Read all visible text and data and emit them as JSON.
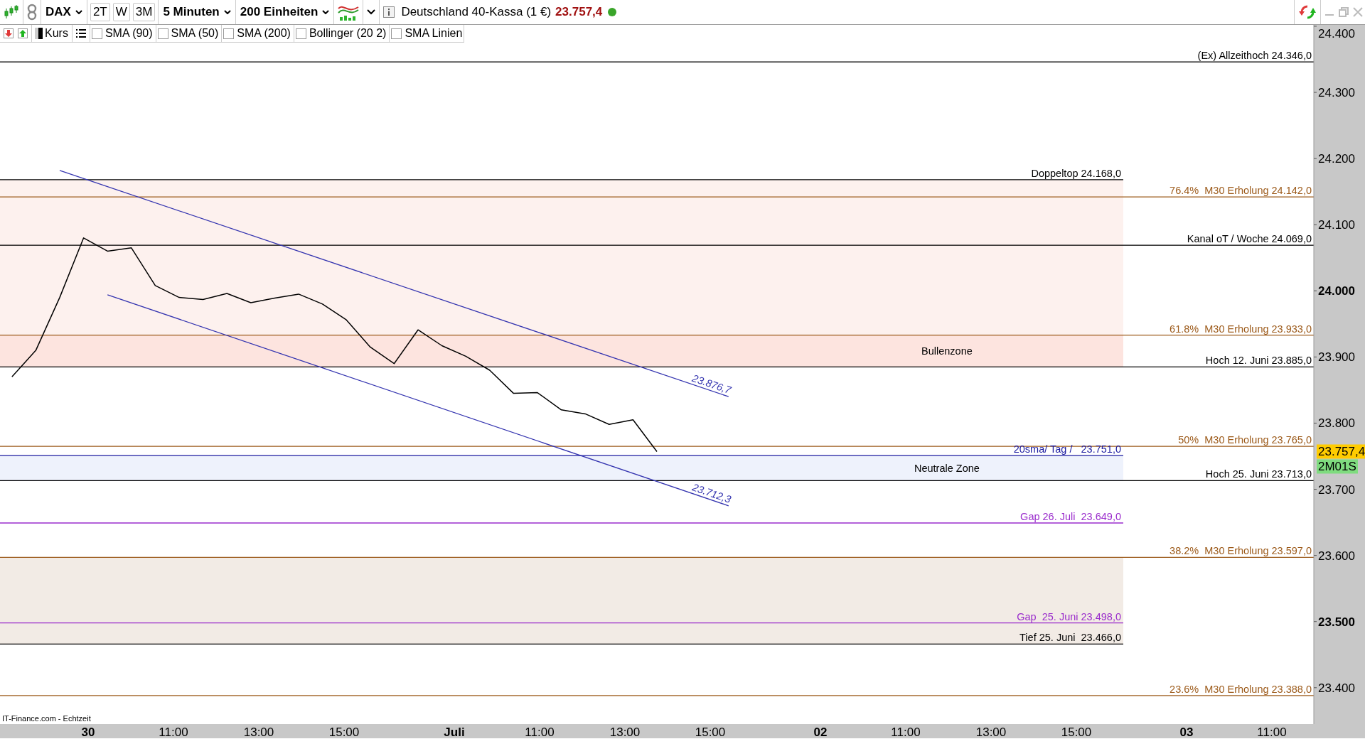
{
  "toolbar": {
    "ranges": [
      {
        "label": "2T"
      },
      {
        "label": "W"
      },
      {
        "label": "3M"
      }
    ],
    "interval": "5 Minuten",
    "units": "200 Einheiten",
    "instrument": "Deutschland 40-Kassa (1 €)",
    "price": "23.757,4",
    "live": true
  },
  "indicator_bar": {
    "indicators": [
      {
        "label": "SMA (90)",
        "checked": false
      },
      {
        "label": "SMA (50)",
        "checked": false
      },
      {
        "label": "SMA (200)",
        "checked": false
      },
      {
        "label": "Bollinger (20 2)",
        "checked": false
      },
      {
        "label": "SMA Linien",
        "checked": false
      }
    ]
  },
  "chart": {
    "price_tag": "23.757,4",
    "timer_tag": "2M01S",
    "source": "IT-Finance.com - Echtzeit",
    "x_axis": [
      {
        "label": "30",
        "kind": "date"
      },
      {
        "label": "11:00",
        "kind": "time"
      },
      {
        "label": "13:00",
        "kind": "time"
      },
      {
        "label": "15:00",
        "kind": "time"
      },
      {
        "label": "Juli",
        "kind": "date"
      },
      {
        "label": "11:00",
        "kind": "time"
      },
      {
        "label": "13:00",
        "kind": "time"
      },
      {
        "label": "15:00",
        "kind": "time"
      },
      {
        "label": "02",
        "kind": "date"
      },
      {
        "label": "11:00",
        "kind": "time"
      },
      {
        "label": "13:00",
        "kind": "time"
      },
      {
        "label": "15:00",
        "kind": "time"
      },
      {
        "label": "03",
        "kind": "date"
      },
      {
        "label": "11:00",
        "kind": "time"
      }
    ],
    "level_layout": [
      {
        "kind": "full"
      },
      {
        "kind": "zone"
      },
      {
        "kind": "full"
      },
      {
        "kind": "full"
      },
      {
        "kind": "full"
      },
      {
        "kind": "full"
      },
      {
        "kind": "full"
      },
      {
        "kind": "zone"
      },
      {
        "kind": "full"
      },
      {
        "kind": "zone"
      },
      {
        "kind": "full"
      },
      {
        "kind": "zone"
      },
      {
        "kind": "zone"
      },
      {
        "kind": "full"
      }
    ],
    "chart_data": {
      "type": "line",
      "title": "DAX",
      "ylim": [
        23345,
        24401
      ],
      "series": [
        {
          "name": "Kurs",
          "color": "#000000",
          "values": [
            23870,
            23910,
            23990,
            24080,
            24060,
            24065,
            24008,
            23990,
            23987,
            23996,
            23982,
            23989,
            23995,
            23980,
            23956,
            23915,
            23890,
            23941,
            23917,
            23901,
            23880,
            23845,
            23846,
            23820,
            23814,
            23798,
            23805,
            23757,
            null,
            null,
            null,
            null,
            null,
            null,
            null,
            null,
            null,
            null,
            null,
            null,
            null,
            null,
            null,
            null,
            null,
            null,
            null,
            null,
            null,
            null,
            null,
            null,
            null,
            null,
            null
          ]
        },
        {
          "name": "23.876,7",
          "color": "#3535b0",
          "values": [
            null,
            null,
            24182,
            null,
            null,
            null,
            null,
            null,
            null,
            null,
            null,
            null,
            null,
            null,
            null,
            null,
            null,
            null,
            null,
            null,
            null,
            null,
            null,
            null,
            null,
            null,
            null,
            null,
            null,
            null,
            23840,
            null,
            null,
            null,
            null,
            null,
            null,
            null,
            null,
            null,
            null,
            null,
            null,
            null,
            null,
            null,
            null,
            null,
            null,
            null,
            null,
            null,
            null,
            null,
            null
          ]
        },
        {
          "name": "23.712,3",
          "color": "#3535b0",
          "values": [
            null,
            null,
            null,
            null,
            23994,
            null,
            null,
            null,
            null,
            null,
            null,
            null,
            null,
            null,
            null,
            null,
            null,
            null,
            null,
            null,
            null,
            null,
            null,
            null,
            null,
            null,
            null,
            null,
            null,
            null,
            23675,
            null,
            null,
            null,
            null,
            null,
            null,
            null,
            null,
            null,
            null,
            null,
            null,
            null,
            null,
            null,
            null,
            null,
            null,
            null,
            null,
            null,
            null,
            null,
            null
          ]
        }
      ],
      "yticks": [
        {
          "value": 24400,
          "label": "24.400"
        },
        {
          "value": 24300,
          "label": "24.300"
        },
        {
          "value": 24200,
          "label": "24.200"
        },
        {
          "value": 24100,
          "label": "24.100"
        },
        {
          "value": 24000,
          "label": "24.000"
        },
        {
          "value": 23900,
          "label": "23.900"
        },
        {
          "value": 23800,
          "label": "23.800"
        },
        {
          "value": 23700,
          "label": "23.700"
        },
        {
          "value": 23600,
          "label": "23.600"
        },
        {
          "value": 23500,
          "label": "23.500"
        },
        {
          "value": 23400,
          "label": "23.400"
        }
      ],
      "bands": [
        {
          "axis": "y",
          "from": 24168,
          "to": 23933,
          "color": "#fdf1ee"
        },
        {
          "axis": "y",
          "from": 23933,
          "to": 23885,
          "color": "#fde4df",
          "label": "Bullenzone"
        },
        {
          "axis": "y",
          "from": 23751,
          "to": 23713,
          "color": "#eef2fc",
          "label": "Neutrale Zone"
        },
        {
          "axis": "y",
          "from": 23597,
          "to": 23466,
          "color": "#f2ebe5"
        }
      ],
      "ref_lines": [
        {
          "axis": "y",
          "value": 24346,
          "label": "(Ex) Allzeithoch 24.346,0",
          "color": "#000000"
        },
        {
          "axis": "y",
          "value": 24168,
          "label": "Doppeltop 24.168,0",
          "color": "#000000"
        },
        {
          "axis": "y",
          "value": 24142,
          "label": "76.4%  M30 Erholung 24.142,0",
          "color": "#9c5a1a"
        },
        {
          "axis": "y",
          "value": 24069,
          "label": "Kanal oT / Woche 24.069,0",
          "color": "#000000"
        },
        {
          "axis": "y",
          "value": 23933,
          "label": "61.8%  M30 Erholung 23.933,0",
          "color": "#9c5a1a"
        },
        {
          "axis": "y",
          "value": 23885,
          "label": "Hoch 12. Juni 23.885,0",
          "color": "#000000"
        },
        {
          "axis": "y",
          "value": 23765,
          "label": "50%  M30 Erholung 23.765,0",
          "color": "#9c5a1a"
        },
        {
          "axis": "y",
          "value": 23751,
          "label": "20sma/ Tag /   23.751,0",
          "color": "#1a1aa0"
        },
        {
          "axis": "y",
          "value": 23713,
          "label": "Hoch 25. Juni 23.713,0",
          "color": "#000000"
        },
        {
          "axis": "y",
          "value": 23649,
          "label": "Gap 26. Juli  23.649,0",
          "color": "#9a2ccc"
        },
        {
          "axis": "y",
          "value": 23597,
          "label": "38.2%  M30 Erholung 23.597,0",
          "color": "#9c5a1a"
        },
        {
          "axis": "y",
          "value": 23498,
          "label": "Gap  25. Juni 23.498,0",
          "color": "#9a2ccc"
        },
        {
          "axis": "y",
          "value": 23466,
          "label": "Tief 25. Juni  23.466,0",
          "color": "#000000"
        },
        {
          "axis": "y",
          "value": 23388,
          "label": "23.6%  M30 Erholung 23.388,0",
          "color": "#9c5a1a"
        }
      ]
    }
  }
}
